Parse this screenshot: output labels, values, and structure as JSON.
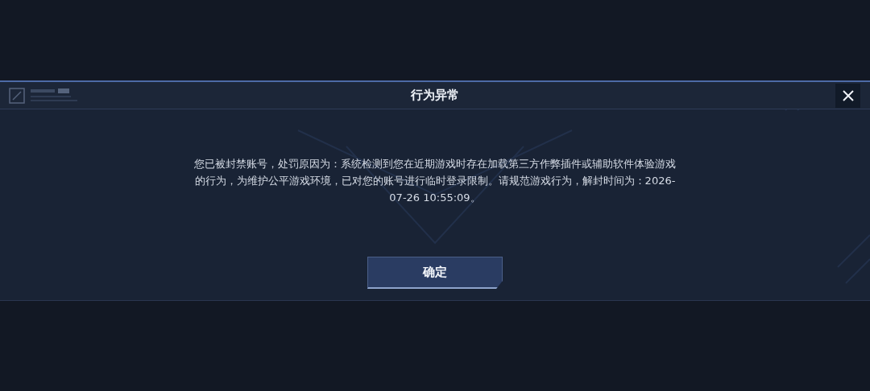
{
  "dialog": {
    "title": "行为异常",
    "message": "您已被封禁账号，处罚原因为：系统检测到您在近期游戏时存在加载第三方作弊插件或辅助软件体验游戏的行为，为维护公平游戏环境，已对您的账号进行临时登录限制。请规范游戏行为，解封时间为：2026-07-26 10:55:09。",
    "buttons": [
      {
        "label": "确定"
      }
    ]
  }
}
